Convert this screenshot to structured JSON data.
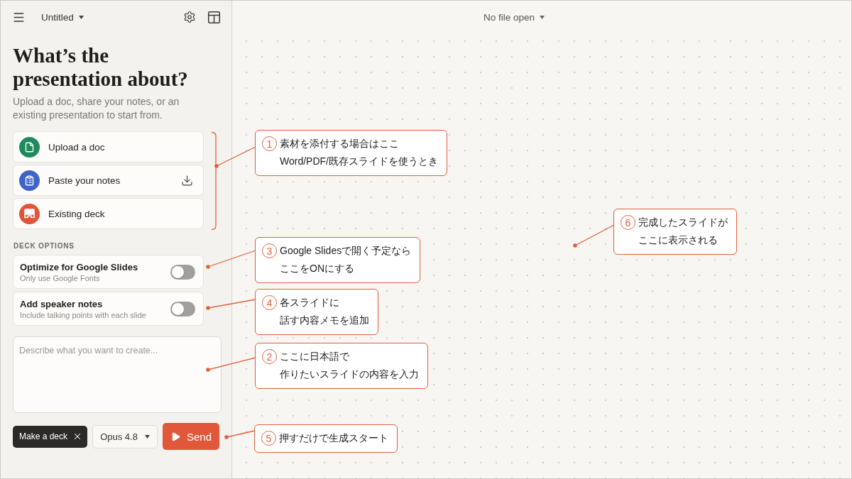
{
  "sidebar": {
    "header": {
      "title": "Untitled"
    },
    "heading": "What’s the presentation about?",
    "subtitle": "Upload a doc, share your notes, or an existing presentation to start from.",
    "sources": [
      {
        "kind": "doc",
        "label": "Upload a doc",
        "color": "#1f8a5b"
      },
      {
        "kind": "notes",
        "label": "Paste your notes",
        "color": "#3e63c9"
      },
      {
        "kind": "deck",
        "label": "Existing deck",
        "color": "#e0543a"
      }
    ],
    "deck_options": {
      "heading": "DECK OPTIONS",
      "options": [
        {
          "label": "Optimize for Google Slides",
          "description": "Only use Google Fonts",
          "on": false
        },
        {
          "label": "Add speaker notes",
          "description": "Include talking points with each slide",
          "on": false
        }
      ]
    },
    "prompt": {
      "placeholder": "Describe what you want to create..."
    },
    "composer": {
      "mode": "Make a deck",
      "model": "Opus 4.8",
      "send": "Send"
    }
  },
  "canvas": {
    "file_menu": "No file open"
  },
  "annotations": [
    {
      "number": "1",
      "lines": [
        "素材を添付する場合はここ",
        "Word/PDF/既存スライドを使うとき"
      ]
    },
    {
      "number": "6",
      "lines": [
        "完成したスライドが",
        "ここに表示される"
      ]
    },
    {
      "number": "3",
      "lines": [
        "Google Slidesで開く予定なら",
        "ここをONにする"
      ]
    },
    {
      "number": "4",
      "lines": [
        "各スライドに",
        "話す内容メモを追加"
      ]
    },
    {
      "number": "2",
      "lines": [
        "ここに日本語で",
        "作りたいスライドの内容を入力"
      ]
    },
    {
      "number": "5",
      "lines": [
        "押すだけで生成スタート"
      ]
    }
  ]
}
